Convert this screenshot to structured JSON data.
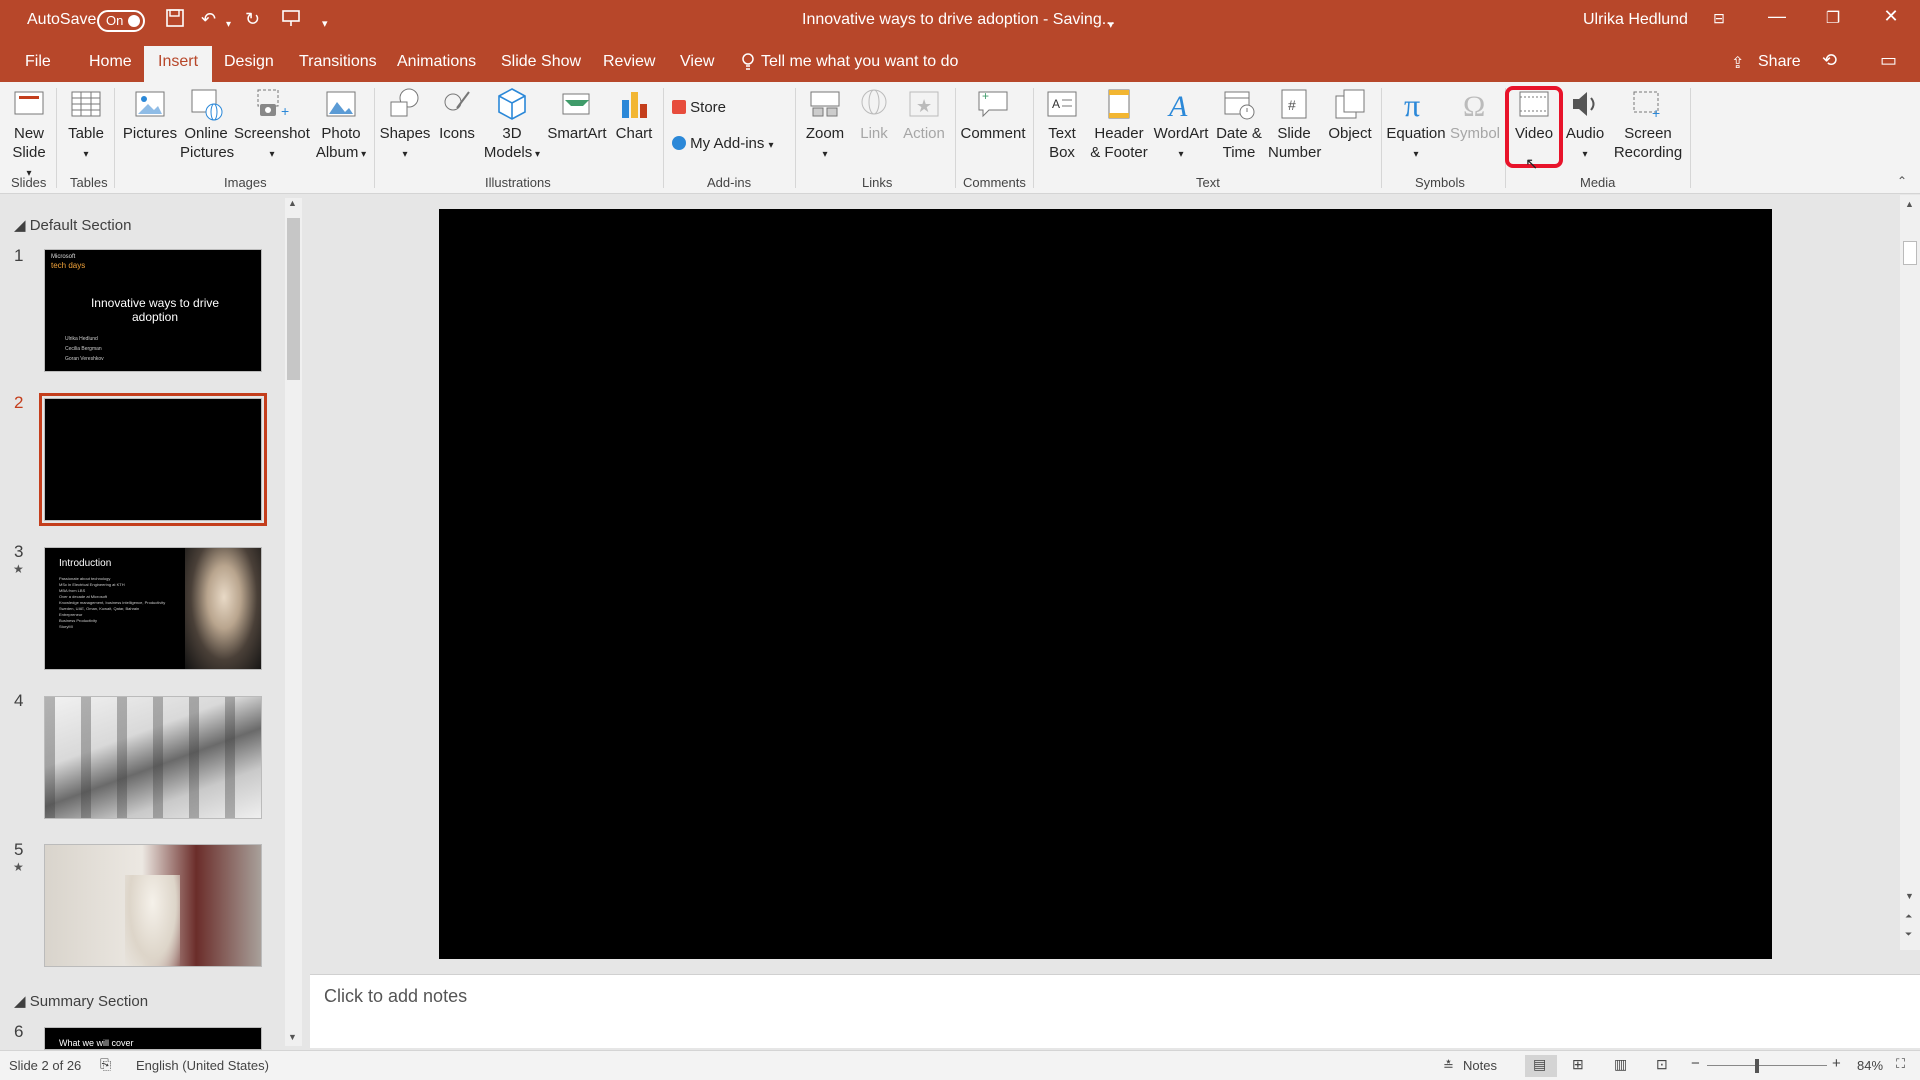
{
  "titlebar": {
    "autosave_label": "AutoSave",
    "autosave_state": "On",
    "document_title": "Innovative ways to drive adoption  -  Saving...",
    "user_name": "Ulrika Hedlund"
  },
  "tabs": [
    "File",
    "Home",
    "Insert",
    "Design",
    "Transitions",
    "Animations",
    "Slide Show",
    "Review",
    "View"
  ],
  "active_tab": "Insert",
  "tell_me": "Tell me what you want to do",
  "share_label": "Share",
  "ribbon": {
    "slides": {
      "new_slide": "New\nSlide",
      "group": "Slides"
    },
    "tables": {
      "table": "Table",
      "group": "Tables"
    },
    "images": {
      "pictures": "Pictures",
      "online_pictures": "Online\nPictures",
      "screenshot": "Screenshot",
      "photo_album": "Photo\nAlbum",
      "group": "Images"
    },
    "illustrations": {
      "shapes": "Shapes",
      "icons": "Icons",
      "models_3d": "3D\nModels",
      "smartart": "SmartArt",
      "chart": "Chart",
      "group": "Illustrations"
    },
    "addins": {
      "store": "Store",
      "my_addins": "My Add-ins",
      "group": "Add-ins"
    },
    "links": {
      "zoom": "Zoom",
      "link": "Link",
      "action": "Action",
      "group": "Links"
    },
    "comments": {
      "comment": "Comment",
      "group": "Comments"
    },
    "text": {
      "text_box": "Text\nBox",
      "header_footer": "Header\n& Footer",
      "wordart": "WordArt",
      "date_time": "Date &\nTime",
      "slide_number": "Slide\nNumber",
      "object": "Object",
      "group": "Text"
    },
    "symbols": {
      "equation": "Equation",
      "symbol": "Symbol",
      "group": "Symbols"
    },
    "media": {
      "video": "Video",
      "audio": "Audio",
      "screen_recording": "Screen\nRecording",
      "group": "Media"
    }
  },
  "thumbnails": {
    "sections": [
      "Default Section",
      "Summary Section"
    ],
    "slides": [
      {
        "num": "1",
        "title": "Innovative ways to drive adoption",
        "brand": "Microsoft",
        "event": "tech days",
        "names": [
          "Ulrika Hedlund",
          "Cecilia Bergman",
          "Goran Vereshkov"
        ]
      },
      {
        "num": "2"
      },
      {
        "num": "3",
        "title": "Introduction",
        "bullets": [
          "Passionate about technology",
          "MSc in Electrical Engineering at KTH",
          "MBA from LBS",
          "Over a decade at Microsoft",
          "Knowledge management, business intelligence, Productivity",
          "Sweden, UAE, Oman, Kuwait, Qatar, Bahrain",
          "Entrepreneur",
          "Business Productivity",
          "StoryMI"
        ]
      },
      {
        "num": "4"
      },
      {
        "num": "5"
      },
      {
        "num": "6",
        "title": "What we will cover"
      }
    ]
  },
  "notes_placeholder": "Click to add notes",
  "statusbar": {
    "slide_info": "Slide 2 of 26",
    "language": "English (United States)",
    "notes_label": "Notes",
    "zoom": "84%"
  }
}
